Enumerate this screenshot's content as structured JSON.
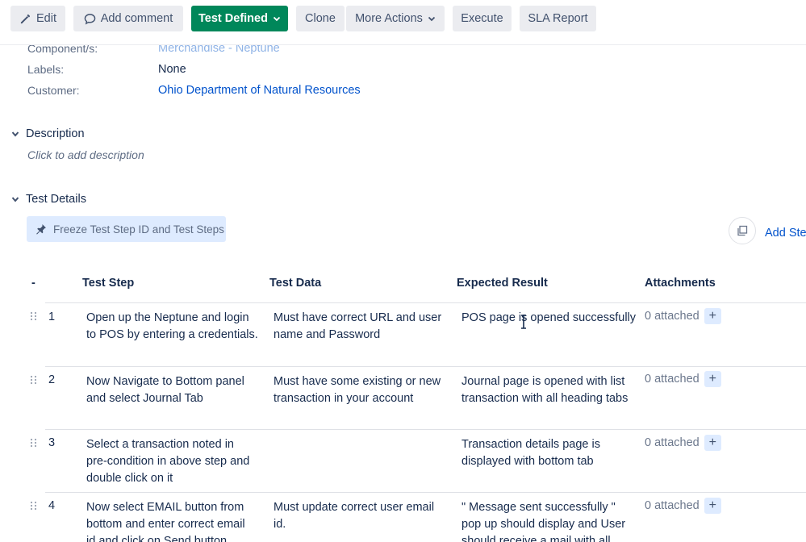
{
  "toolbar": {
    "edit": "Edit",
    "add_comment": "Add comment",
    "status": "Test Defined",
    "clone": "Clone",
    "more_actions": "More Actions",
    "execute": "Execute",
    "sla_report": "SLA Report"
  },
  "fields": {
    "components_label": "Component/s:",
    "components_value": "Merchandise - Neptune",
    "labels_label": "Labels:",
    "labels_value": "None",
    "customer_label": "Customer:",
    "customer_value": "Ohio Department of Natural Resources"
  },
  "description": {
    "title": "Description",
    "placeholder": "Click to add description"
  },
  "test_details": {
    "title": "Test Details",
    "freeze_button": "Freeze Test Step ID and Test Steps",
    "add_step": "Add Ste"
  },
  "table": {
    "columns": [
      "-",
      "Test Step",
      "Test Data",
      "Expected Result",
      "Attachments"
    ],
    "rows": [
      {
        "num": "1",
        "step": [
          "Open up the Neptune and login",
          "to POS by entering a credentials."
        ],
        "data": [
          "Must have correct URL and user",
          "name and Password"
        ],
        "result": [
          "POS page is opened successfully"
        ],
        "attachments": "0 attached"
      },
      {
        "num": "2",
        "step": [
          "Now Navigate to Bottom panel",
          "and select Journal Tab"
        ],
        "data": [
          "Must have some existing or new",
          "transaction in your account"
        ],
        "result": [
          "Journal page is opened with list",
          "transaction with all heading tabs"
        ],
        "attachments": "0 attached"
      },
      {
        "num": "3",
        "step": [
          "Select a transaction noted in",
          "pre-condition in above step and",
          "double click on it"
        ],
        "data": [],
        "result": [
          "Transaction details page is",
          "displayed with bottom tab"
        ],
        "attachments": "0 attached"
      },
      {
        "num": "4",
        "step": [
          "Now select EMAIL button from",
          "bottom and enter correct email",
          "id and click on Send button"
        ],
        "data": [
          "Must update correct user email",
          "id."
        ],
        "result": [
          "\" Message sent successfully \"",
          "pop up should display and User",
          "should receive a mail with all"
        ],
        "attachments": "0 attached"
      }
    ]
  },
  "icons": {
    "edit": "pencil-icon",
    "comment": "speech-bubble-icon",
    "dropdown": "chevron-down-icon",
    "caret": "caret-down-icon",
    "pin": "pin-icon",
    "add_step": "copy-icon",
    "drag": "drag-handle-icon",
    "plus": "plus-icon"
  },
  "colors": {
    "primary": "#00875a",
    "link": "#0052cc",
    "button_bg": "#ebecf0",
    "highlight_bg": "#deebff"
  }
}
